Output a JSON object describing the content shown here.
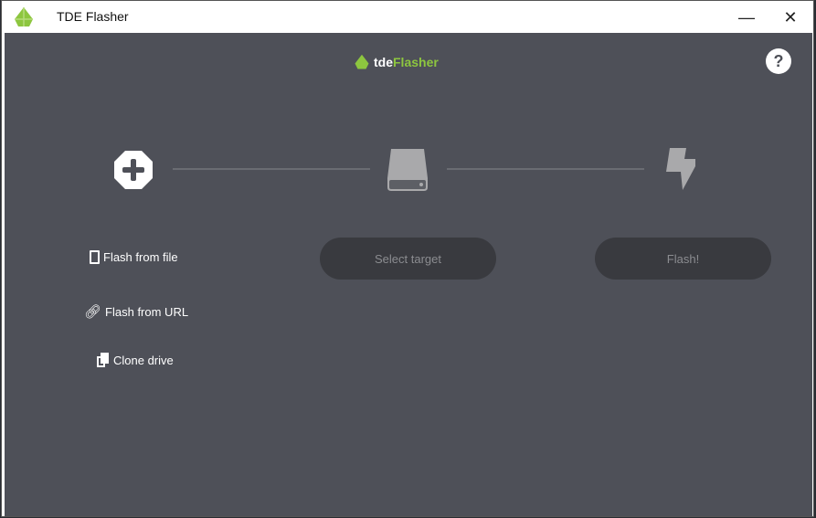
{
  "window": {
    "title": "TDE Flasher",
    "minimize": "—",
    "close": "✕"
  },
  "brand": {
    "prefix": "tde",
    "suffix": "Flasher"
  },
  "help": "?",
  "sources": [
    {
      "label": "Flash from file"
    },
    {
      "label": "Flash from URL"
    },
    {
      "label": "Clone drive"
    }
  ],
  "buttons": {
    "select_target": "Select target",
    "flash": "Flash!"
  },
  "colors": {
    "accent": "#8dc63f",
    "background": "#4e5058",
    "button": "#393a3f"
  }
}
